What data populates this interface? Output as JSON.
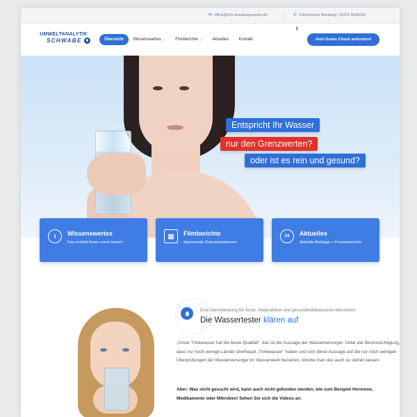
{
  "topbar": {
    "email": "office@h2o-beratungscenter.de",
    "phone": "Telefonische Beratung: 05321 4696050"
  },
  "logo": {
    "line1": "UMWELTANALYTIK",
    "line2": "SCHWABE"
  },
  "nav": {
    "items": [
      {
        "label": "Übersicht",
        "active": true,
        "dropdown": false
      },
      {
        "label": "Wissenswertes",
        "active": false,
        "dropdown": true
      },
      {
        "label": "Filmberichte",
        "active": false,
        "dropdown": true
      },
      {
        "label": "Aktuelles",
        "active": false,
        "dropdown": false
      },
      {
        "label": "Kontakt",
        "active": false,
        "dropdown": false
      }
    ],
    "facebook": "f",
    "cta": "Jetzt Gratis Check anfordern!"
  },
  "hero": {
    "line1": "Entspricht Ihr Wasser",
    "line2": "nur den Grenzwerten?",
    "line3": "oder ist es rein und gesund?"
  },
  "features": [
    {
      "icon": "info-icon",
      "glyph": "i",
      "title": "Wissenswertes",
      "subtitle": "Das erzählt Ihnen sonst keiner!"
    },
    {
      "icon": "clapperboard-icon",
      "glyph": "🎬",
      "title": "Filmberichte",
      "subtitle": "Spannende Dokumentationen"
    },
    {
      "icon": "24h-icon",
      "glyph": "24",
      "title": "Aktuelles",
      "subtitle": "Aktuelle Beiträge + Presseberichte"
    }
  ],
  "content": {
    "intro": "Eine Dienstleistung für Ärzte, Heilpraktiker und gesundheitsbewusste Menschen:",
    "heading_main": "Die Wassertester",
    "heading_highlight": "klären auf",
    "paragraph1": "„Unser Trinkwasser hat die beste Qualität\", das ist die Aussage der Wasserversorger. Unter der Berücksichtigung, dass nur noch wenige Länder überhaupt „Trinkwasser\" haben und sich diese Aussage auf die nur noch wenigen Überprüfungen der Wasserversorger im Wasserwerk beziehen, könnte man das auch so stehen lassen.",
    "paragraph2": "Aber: Was nicht gesucht wird, kann auch nicht gefunden werden, wie zum Beispiel Hormone, Medikamente oder Mikroben! Sehen Sie sich die Videos an:"
  },
  "colors": {
    "brand_blue": "#2f6fd6",
    "highlight_red": "#e3312b",
    "feature_blue": "#3f7ce3"
  }
}
